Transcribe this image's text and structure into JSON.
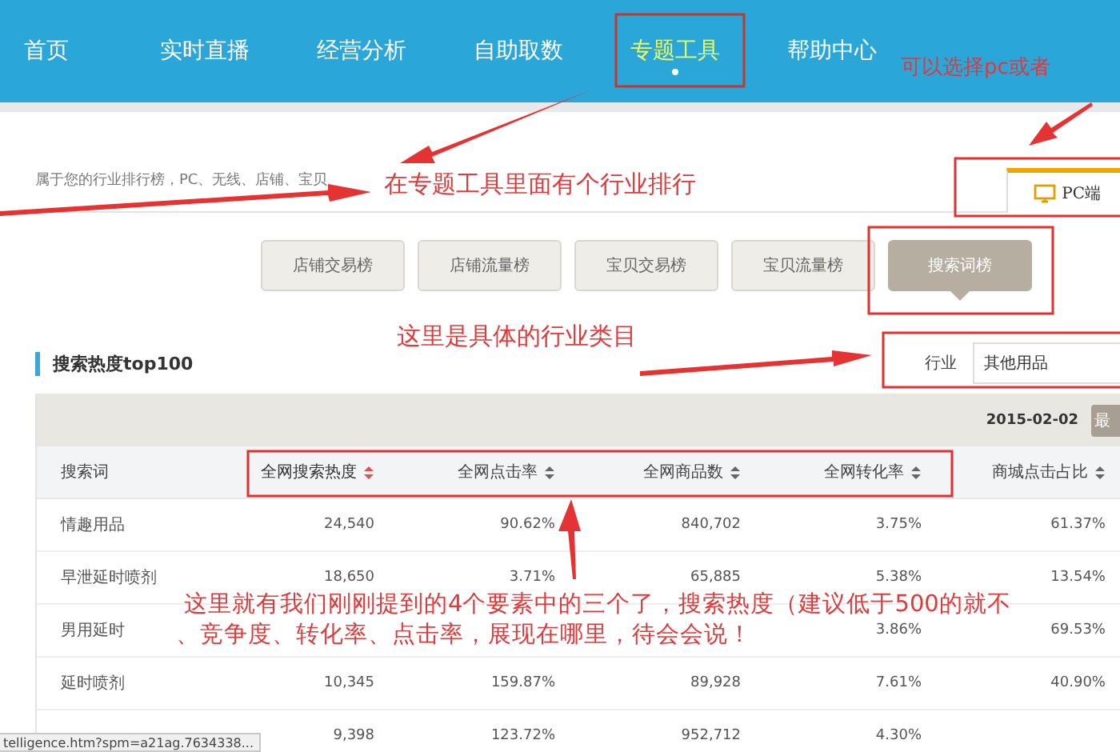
{
  "nav": {
    "items": [
      {
        "label": "首页",
        "selected": false
      },
      {
        "label": "实时直播",
        "selected": false
      },
      {
        "label": "经营分析",
        "selected": false
      },
      {
        "label": "自助取数",
        "selected": false
      },
      {
        "label": "专题工具",
        "selected": true
      },
      {
        "label": "帮助中心",
        "selected": false
      }
    ]
  },
  "intro": "属于您的行业排行榜，PC、无线、店铺、宝贝",
  "device_tab": {
    "label": "PC端",
    "selected": true
  },
  "rank_tabs": [
    {
      "label": "店铺交易榜",
      "selected": false
    },
    {
      "label": "店铺流量榜",
      "selected": false
    },
    {
      "label": "宝贝交易榜",
      "selected": false
    },
    {
      "label": "宝贝流量榜",
      "selected": false
    },
    {
      "label": "搜索词榜",
      "selected": true
    }
  ],
  "section_title": "搜索热度top100",
  "industry": {
    "label": "行业",
    "value": "其他用品"
  },
  "table": {
    "date": "2015-02-02",
    "button": "最",
    "columns": [
      {
        "label": "搜索词",
        "sortable": false,
        "selected": false
      },
      {
        "label": "全网搜索热度",
        "sortable": true,
        "selected": true
      },
      {
        "label": "全网点击率",
        "sortable": true,
        "selected": false
      },
      {
        "label": "全网商品数",
        "sortable": true,
        "selected": false
      },
      {
        "label": "全网转化率",
        "sortable": true,
        "selected": false
      },
      {
        "label": "商城点击占比",
        "sortable": true,
        "selected": false
      }
    ],
    "rows": [
      [
        "情趣用品",
        "24,540",
        "90.62%",
        "840,702",
        "3.75%",
        "61.37%"
      ],
      [
        "早泄延时喷剂",
        "18,650",
        "3.71%",
        "65,885",
        "5.38%",
        "13.54%"
      ],
      [
        "男用延时",
        null,
        null,
        null,
        "3.86%",
        "69.53%"
      ],
      [
        "延时喷剂",
        "10,345",
        "159.87%",
        "89,928",
        "7.61%",
        "40.90%"
      ],
      [
        null,
        "9,398",
        "123.72%",
        "952,712",
        "4.30%",
        null
      ]
    ]
  },
  "annotations": [
    {
      "text": "可以选择pc或者"
    },
    {
      "text": "在专题工具里面有个行业排行"
    },
    {
      "text": "这里是具体的行业类目"
    },
    {
      "text": "这里就有我们刚刚提到的4个要素中的三个了，搜索热度（建议低于500的就不"
    },
    {
      "text": "、竞争度、转化率、点击率，展现在哪里，待会会说！"
    }
  ],
  "status_bar": {
    "url": "telligence.htm?spm=a21ag.7634338..."
  }
}
